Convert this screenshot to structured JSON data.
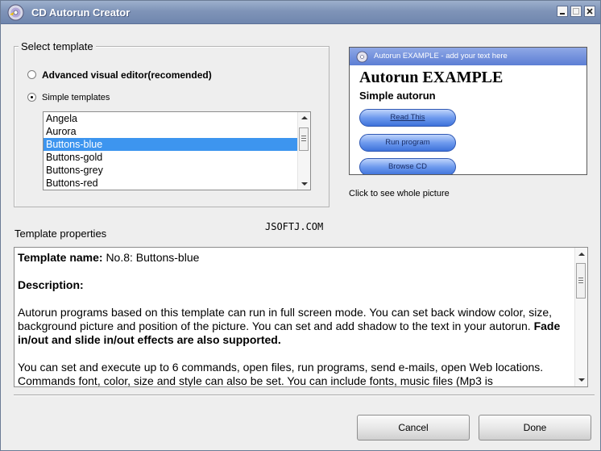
{
  "window": {
    "title": "CD Autorun Creator"
  },
  "select_template": {
    "title": "Select template",
    "option_advanced": "Advanced visual editor(recomended)",
    "option_simple": "Simple templates",
    "selected_option": "simple",
    "templates": [
      "Angela",
      "Aurora",
      "Buttons-blue",
      "Buttons-gold",
      "Buttons-grey",
      "Buttons-red"
    ],
    "selected_template": "Buttons-blue"
  },
  "preview": {
    "window_title": "Autorun EXAMPLE - add your text here",
    "heading": "Autorun EXAMPLE",
    "subheading": "Simple autorun",
    "buttons": [
      "Read This",
      "Run program",
      "Browse CD"
    ],
    "caption": "Click to see whole picture",
    "colors": {
      "title_bar": "#5c7ed4",
      "button": "#6e9aee"
    }
  },
  "watermark": "JSOFTJ.COM",
  "properties": {
    "title": "Template properties",
    "name_label": "Template name:",
    "name_value": "No.8: Buttons-blue",
    "description_label": "Description:",
    "para1": "Autorun programs based on this template can run in full screen mode. You can set back window color, size, background picture and position of the picture. You can set and add shadow to the text in your autorun.",
    "para1_bold": "Fade in/out and slide in/out effects are also supported.",
    "para2": "You can set and execute up to 6 commands, open files, run programs, send e-mails, open Web locations. Commands font, color, size and style can also be set. You can include fonts, music files (Mp3 is"
  },
  "buttons": {
    "cancel": "Cancel",
    "done": "Done"
  },
  "colors": {
    "selection": "#3d95ef",
    "titlebar": "#7f94b8"
  }
}
